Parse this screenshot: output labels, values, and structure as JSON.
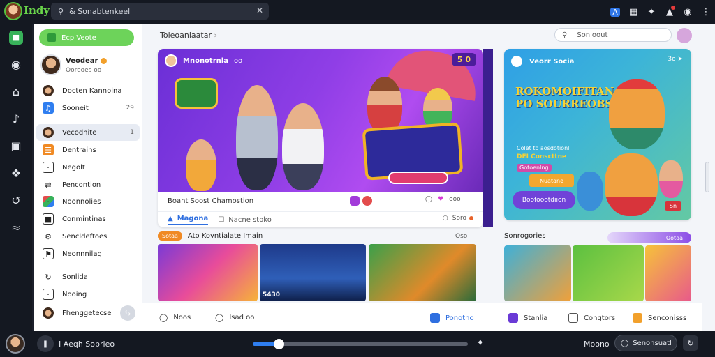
{
  "app": {
    "name": "Indy"
  },
  "top_search": {
    "value": "& Sonabtenkeel",
    "clear_icon": "close-icon"
  },
  "top_icons": [
    "translate-icon",
    "grid-icon",
    "sparkle-icon",
    "bell-icon",
    "record-icon",
    "more-vert-icon"
  ],
  "rail": [
    "home-icon",
    "compass-icon",
    "house-icon",
    "music-notification-icon",
    "book-icon",
    "puzzle-icon",
    "history-icon",
    "wifi-icon"
  ],
  "sidebar": {
    "create_button": "Ecp Veote",
    "profile": {
      "name": "Veodear",
      "sub": "Ooreoes oo"
    },
    "items": [
      {
        "label": "Docten Kannoina",
        "icon": "avatar-icon",
        "count": ""
      },
      {
        "label": "Sooneit",
        "icon": "music-note-icon",
        "count": "29"
      },
      {
        "label": "Vecodnite",
        "icon": "avatar-icon",
        "count": "1"
      },
      {
        "label": "Dentrains",
        "icon": "list-icon",
        "count": ""
      },
      {
        "label": "Negolt",
        "icon": "calendar-icon",
        "count": ""
      },
      {
        "label": "Pencontion",
        "icon": "shuffle-icon",
        "count": ""
      },
      {
        "label": "Noonnolies",
        "icon": "apps-icon",
        "count": ""
      },
      {
        "label": "Conmintinas",
        "icon": "folder-icon",
        "count": ""
      },
      {
        "label": "Sencldeftoes",
        "icon": "settings-icon",
        "count": ""
      },
      {
        "label": "Neonnnilag",
        "icon": "flag-icon",
        "count": ""
      },
      {
        "label": "Sonlida",
        "icon": "route-icon",
        "count": ""
      },
      {
        "label": "Nooing",
        "icon": "bookmark-icon",
        "count": ""
      },
      {
        "label": "Fhenggetecse",
        "icon": "avatar-icon",
        "count": ""
      }
    ]
  },
  "main": {
    "title": "Toleoanlaatar",
    "search_placeholder": "Sonloout",
    "hero": {
      "channel": "Mnonotrnla",
      "channel_meta": "oo",
      "corner": "5 0",
      "caption": "Boant Soost Chamostion",
      "likes": "ooo",
      "tab_active": "Magona",
      "tab_other": "Nacne stoko",
      "tab_right": "Soro"
    },
    "side_card": {
      "title": "Veorr Socia",
      "meta": "3o",
      "headline": "ROKOMOIFITAN PO SOURREOBS",
      "line1": "Colet to aosdotionl",
      "line2": "DEI Conscttne",
      "line3": "Gotoenlng",
      "chip": "Nuatane",
      "cta": "Boofoootdiion",
      "mini": "Sn"
    },
    "row": {
      "tag": "Sotaa",
      "heading": "Ato Kovntialate Imain",
      "right": "Oso",
      "thumbs": [
        "",
        "5430",
        ""
      ]
    },
    "sec": {
      "heading": "Sonrogories",
      "pill": "Ootaa"
    },
    "bottom": [
      {
        "label": "Noos",
        "icon": "chat-icon"
      },
      {
        "label": "Isad oo",
        "icon": "comment-icon"
      },
      {
        "label": "Ponotno",
        "icon": "pen-icon"
      },
      {
        "label": "Stanlia",
        "icon": "bar-chart-icon"
      },
      {
        "label": "Congtors",
        "icon": "box-icon"
      },
      {
        "label": "Senconisss",
        "icon": "star-icon"
      }
    ]
  },
  "player": {
    "title": "I Aeqh Soprieo",
    "progress": 0.12,
    "label": "Moono",
    "button": "Senonsuatl",
    "play_icon": "pause-icon",
    "share_icon": "share-icon",
    "end_icon": "repeat-icon"
  }
}
